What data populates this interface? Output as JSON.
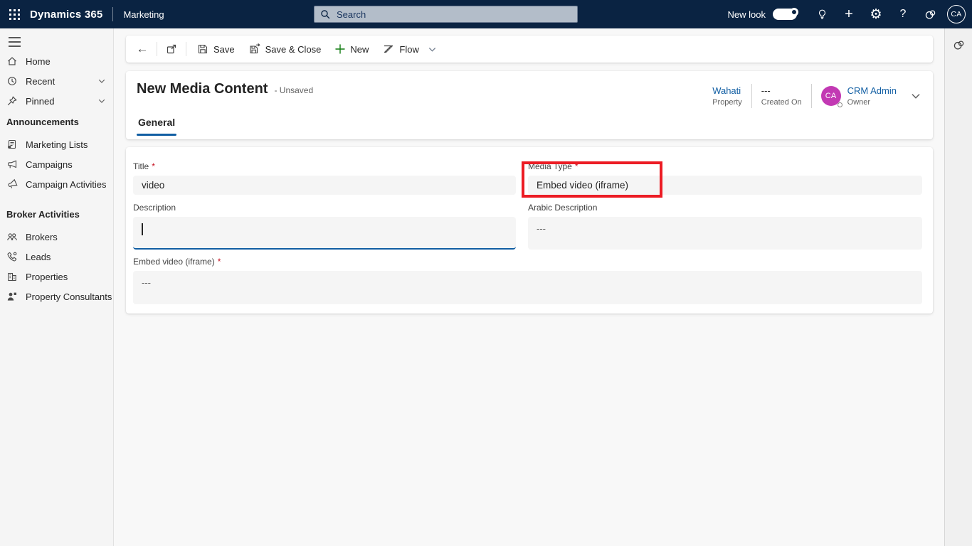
{
  "topbar": {
    "brand": "Dynamics 365",
    "app_name": "Marketing",
    "search_placeholder": "Search",
    "new_look_label": "New look",
    "new_look_on": true,
    "avatar_initials": "CA",
    "glyphs": {
      "add": "+",
      "settings": "⚙",
      "help": "?"
    }
  },
  "sidebar": {
    "top_items": [
      {
        "label": "Home"
      },
      {
        "label": "Recent",
        "collapsible": true
      },
      {
        "label": "Pinned",
        "collapsible": true
      }
    ],
    "groups": [
      {
        "header": "Announcements",
        "items": [
          {
            "label": "Marketing Lists"
          },
          {
            "label": "Campaigns"
          },
          {
            "label": "Campaign Activities"
          }
        ]
      },
      {
        "header": "Broker Activities",
        "items": [
          {
            "label": "Brokers"
          },
          {
            "label": "Leads"
          },
          {
            "label": "Properties"
          },
          {
            "label": "Property Consultants"
          }
        ]
      }
    ]
  },
  "command_bar": {
    "back_glyph": "←",
    "buttons": [
      {
        "label": "Save"
      },
      {
        "label": "Save & Close"
      },
      {
        "label": "New"
      },
      {
        "label": "Flow"
      }
    ]
  },
  "record": {
    "title": "New Media Content",
    "status_suffix": "- Unsaved",
    "tabs": [
      {
        "label": "General",
        "active": true
      }
    ],
    "header_fields": [
      {
        "value": "Wahati",
        "label": "Property",
        "is_link": true
      },
      {
        "value": "---",
        "label": "Created On"
      },
      {
        "value": "CRM Admin",
        "label": "Owner",
        "is_link": true,
        "avatar_initials": "CA"
      }
    ]
  },
  "form": {
    "fields": [
      {
        "label": "Title",
        "required": true,
        "value": "video"
      },
      {
        "label": "Media Type",
        "required": true,
        "value": "Embed video (iframe)"
      },
      {
        "label": "Description",
        "value": "",
        "focused": true
      },
      {
        "label": "Arabic Description",
        "value": "---"
      },
      {
        "label": "Embed video (iframe)",
        "required": true,
        "value": "---"
      }
    ],
    "highlight": {
      "field": "Media Type",
      "color": "#ec1c24"
    }
  },
  "ui": {
    "required_marker": "*",
    "colors": {
      "topbar_bg": "#0a2342",
      "accent_blue": "#115ea3",
      "highlight_red": "#ec1c24",
      "avatar_magenta": "#c239b3",
      "new_button_green": "#107c10",
      "field_bg": "#f5f5f5"
    }
  }
}
